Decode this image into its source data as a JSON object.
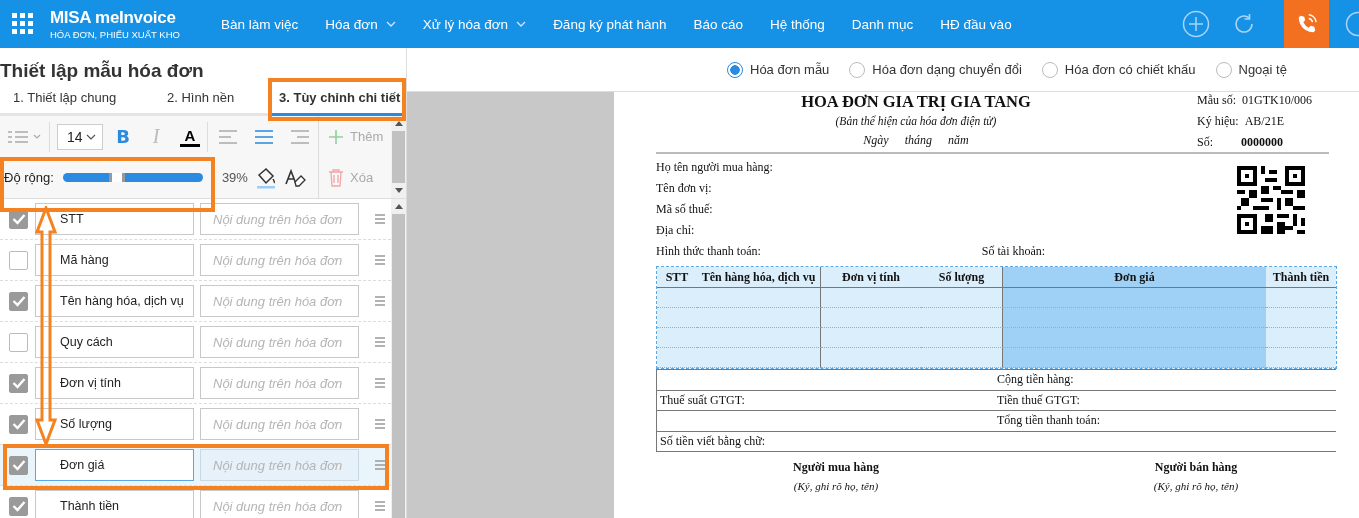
{
  "header": {
    "logo_title": "MISA meInvoice",
    "logo_subtitle": "HÓA ĐƠN, PHIẾU XUẤT KHO",
    "nav": [
      {
        "label": "Bàn làm việc",
        "dropdown": false
      },
      {
        "label": "Hóa đơn",
        "dropdown": true
      },
      {
        "label": "Xử lý hóa đơn",
        "dropdown": true
      },
      {
        "label": "Đăng ký phát hành",
        "dropdown": false
      },
      {
        "label": "Báo cáo",
        "dropdown": false
      },
      {
        "label": "Hệ thống",
        "dropdown": false
      },
      {
        "label": "Danh mục",
        "dropdown": false
      },
      {
        "label": "HĐ đầu vào",
        "dropdown": false
      }
    ]
  },
  "left_panel": {
    "title": "Thiết lập mẫu hóa đơn",
    "tabs": [
      {
        "label": "1. Thiết lập chung",
        "selected": false
      },
      {
        "label": "2. Hình nền",
        "selected": false
      },
      {
        "label": "3. Tùy chỉnh chi tiết",
        "selected": true
      }
    ],
    "toolbar": {
      "font_size": "14",
      "format_buttons": [
        {
          "kind": "bold",
          "glyph": "B"
        },
        {
          "kind": "italic",
          "glyph": "I"
        },
        {
          "kind": "color",
          "glyph": "A"
        }
      ],
      "align_buttons": [
        {
          "kind": "left",
          "selected": false
        },
        {
          "kind": "center",
          "selected": true
        },
        {
          "kind": "right",
          "selected": false
        }
      ],
      "width": {
        "label": "Độ rộng:",
        "level": 0.39,
        "reading": "39%"
      },
      "add_label": "Thêm",
      "delete_label": "Xóa"
    },
    "fields": [
      {
        "name": "STT",
        "placeholder": "Nội dung trên hóa đơn",
        "checked": true,
        "selected": false
      },
      {
        "name": "Mã hàng",
        "placeholder": "Nội dung trên hóa đơn",
        "checked": false,
        "selected": false
      },
      {
        "name": "Tên hàng hóa, dịch vụ",
        "placeholder": "Nội dung trên hóa đơn",
        "checked": true,
        "selected": false
      },
      {
        "name": "Quy cách",
        "placeholder": "Nội dung trên hóa đơn",
        "checked": false,
        "selected": false
      },
      {
        "name": "Đơn vị tính",
        "placeholder": "Nội dung trên hóa đơn",
        "checked": true,
        "selected": false
      },
      {
        "name": "Số lượng",
        "placeholder": "Nội dung trên hóa đơn",
        "checked": true,
        "selected": false
      },
      {
        "name": "Đơn giá",
        "placeholder": "Nội dung trên hóa đơn",
        "checked": true,
        "selected": true
      },
      {
        "name": "Thành tiền",
        "placeholder": "Nội dung trên hóa đơn",
        "checked": true,
        "selected": false
      }
    ]
  },
  "preview": {
    "options": [
      {
        "label": "Hóa đơn mẫu",
        "selected": true
      },
      {
        "label": "Hóa đơn dạng chuyển đổi",
        "selected": false
      },
      {
        "label": "Hóa đơn có chiết khấu",
        "selected": false
      },
      {
        "label": "Ngoại tệ",
        "selected": false
      }
    ],
    "invoice": {
      "title": "HOA ĐƠN GIA TRỊ GIA TANG",
      "subtitle": "(Bản thể hiện của hóa đơn điện tử)",
      "date_parts": [
        "Ngày",
        "tháng",
        "năm"
      ],
      "meta": [
        {
          "label": "Mẫu số:",
          "value": "01GTK10/006"
        },
        {
          "label": "Ký hiệu:",
          "value": "AB/21E"
        },
        {
          "label": "Số:",
          "value": "0000000"
        }
      ],
      "buyer_lines": [
        "Họ tên người mua hàng:",
        "Tên đơn vị:",
        "Mã số thuế:",
        "Địa chỉ:"
      ],
      "payment_label": "Hình thức thanh toán:",
      "account_label": "Số tài khoản:",
      "columns": [
        {
          "label": "STT",
          "selected": false
        },
        {
          "label": "Tên hàng hóa, dịch vụ",
          "selected": false
        },
        {
          "label": "Đơn vị tính",
          "selected": false
        },
        {
          "label": "Số lượng",
          "selected": false
        },
        {
          "label": "Đơn giá",
          "selected": true
        },
        {
          "label": "Thành tiền",
          "selected": false
        }
      ],
      "totals": [
        {
          "right": "Cộng tiền hàng:"
        },
        {
          "left": "Thuế suất GTGT:",
          "right": "Tiền thuế GTGT:"
        },
        {
          "right": "Tổng tiền thanh toán:"
        },
        {
          "left": "Số tiền viết bằng chữ:"
        }
      ],
      "signatures": [
        {
          "role": "Người mua hàng",
          "note": "(Ký, ghi rõ họ, tên)"
        },
        {
          "role": "Người bán hàng",
          "note": "(Ký, ghi rõ họ, tên)"
        }
      ]
    }
  }
}
